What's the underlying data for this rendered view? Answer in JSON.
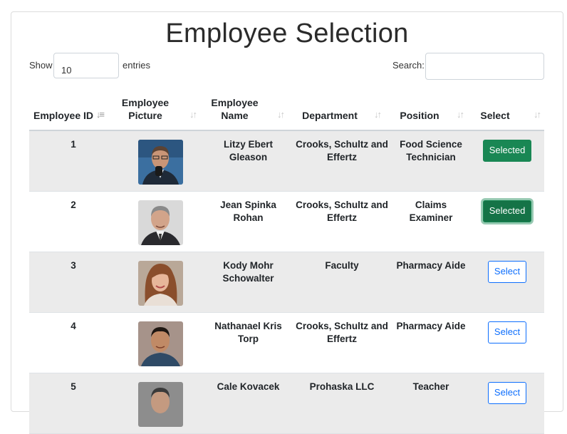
{
  "title": "Employee Selection",
  "length_control": {
    "show_label": "Show",
    "value": "10",
    "entries_label": "entries"
  },
  "search": {
    "label": "Search:",
    "value": ""
  },
  "columns": [
    {
      "label": "Employee ID",
      "sort": "sort-ascending-icon"
    },
    {
      "label": "Employee Picture",
      "sort": "sort-icon"
    },
    {
      "label": "Employee Name",
      "sort": "sort-icon"
    },
    {
      "label": "Department",
      "sort": "sort-icon"
    },
    {
      "label": "Position",
      "sort": "sort-icon"
    },
    {
      "label": "Select",
      "sort": "sort-icon"
    }
  ],
  "rows": [
    {
      "id": "1",
      "name": "Litzy Ebert Gleason",
      "department": "Crooks, Schultz and Effertz",
      "position": "Food Science Technician",
      "action": "Selected",
      "selected": true
    },
    {
      "id": "2",
      "name": "Jean Spinka Rohan",
      "department": "Crooks, Schultz and Effertz",
      "position": "Claims Examiner",
      "action": "Selected",
      "selected": true
    },
    {
      "id": "3",
      "name": "Kody Mohr Schowalter",
      "department": "Faculty",
      "position": "Pharmacy Aide",
      "action": "Select",
      "selected": false
    },
    {
      "id": "4",
      "name": "Nathanael Kris Torp",
      "department": "Crooks, Schultz and Effertz",
      "position": "Pharmacy Aide",
      "action": "Select",
      "selected": false
    },
    {
      "id": "5",
      "name": "Cale Kovacek",
      "department": "Prohaska LLC",
      "position": "Teacher",
      "action": "Select",
      "selected": false
    }
  ],
  "colors": {
    "selected_button": "#198754",
    "select_button": "#0d6efd",
    "stripe": "#ebebeb"
  }
}
